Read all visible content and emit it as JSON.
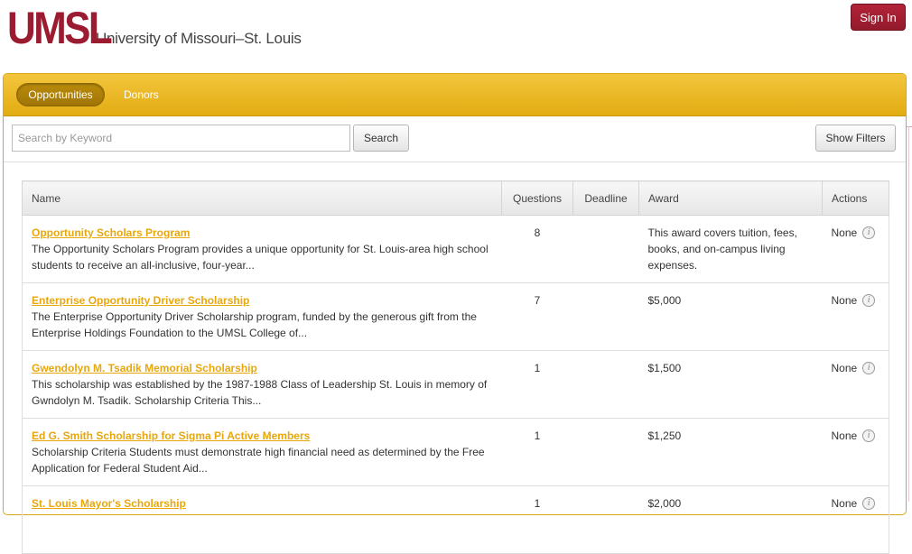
{
  "header": {
    "logo_mark": "UMSL",
    "logo_text": "University of Missouri–St. Louis",
    "sign_in_label": "Sign In"
  },
  "nav": {
    "tabs": [
      {
        "label": "Opportunities",
        "active": true
      },
      {
        "label": "Donors",
        "active": false
      }
    ]
  },
  "toolbar": {
    "search_placeholder": "Search by Keyword",
    "search_value": "",
    "search_label": "Search",
    "filters_label": "Show Filters"
  },
  "table": {
    "columns": [
      "Name",
      "Questions",
      "Deadline",
      "Award",
      "Actions"
    ],
    "rows": [
      {
        "name": "Opportunity Scholars Program",
        "description": "The Opportunity Scholars Program provides a unique opportunity for St. Louis-area high school students to receive an all-inclusive, four-year...",
        "questions": "8",
        "deadline": "",
        "award": "This award covers tuition, fees, books, and on-campus living expenses.",
        "action": "None"
      },
      {
        "name": "Enterprise Opportunity Driver Scholarship",
        "description": "The Enterprise Opportunity Driver Scholarship program, funded by the generous gift from the Enterprise Holdings Foundation to the UMSL College of...",
        "questions": "7",
        "deadline": "",
        "award": "$5,000",
        "action": "None"
      },
      {
        "name": "Gwendolyn M. Tsadik Memorial Scholarship",
        "description": "This scholarship was established by the 1987-1988 Class of Leadership St. Louis in memory of Gwndolyn M. Tsadik. Scholarship Criteria This...",
        "questions": "1",
        "deadline": "",
        "award": "$1,500",
        "action": "None"
      },
      {
        "name": "Ed G. Smith Scholarship for Sigma Pi Active Members",
        "description": "Scholarship Criteria Students must demonstrate high financial need as determined by the Free Application for Federal Student Aid...",
        "questions": "1",
        "deadline": "",
        "award": "$1,250",
        "action": "None"
      },
      {
        "name": "St. Louis Mayor's Scholarship",
        "description": "",
        "questions": "1",
        "deadline": "",
        "award": "$2,000",
        "action": "None"
      }
    ]
  },
  "colors": {
    "brand": "#9b1b30",
    "accent": "#e8a70c",
    "nav_bar": "#f0bb2a"
  },
  "icons": {
    "row_action": "info-icon"
  }
}
